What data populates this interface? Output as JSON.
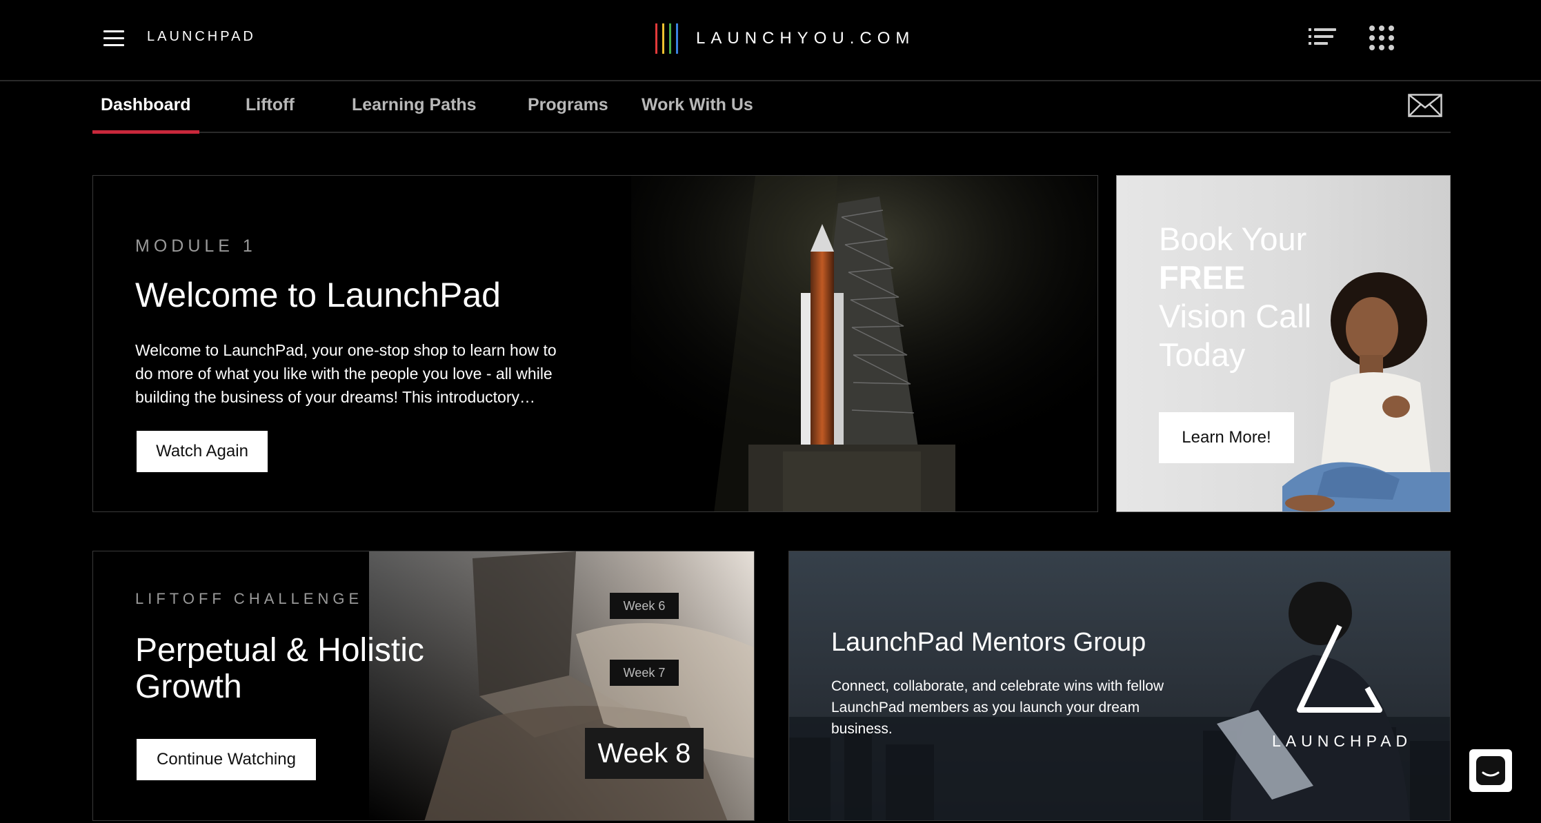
{
  "header": {
    "brand_left": "LAUNCHPAD",
    "logo_text": "LAUNCHYOU.COM",
    "logo_bar_colors": [
      "#e23a3a",
      "#f2c230",
      "#47b04a",
      "#3b82e0"
    ]
  },
  "nav": {
    "tabs": [
      {
        "label": "Dashboard",
        "active": true
      },
      {
        "label": "Liftoff"
      },
      {
        "label": "Learning Paths"
      },
      {
        "label": "Programs"
      },
      {
        "label": "Work With Us"
      }
    ],
    "accent_color": "#c8283b"
  },
  "welcome_card": {
    "eyebrow": "MODULE 1",
    "title": "Welcome to LaunchPad",
    "description": "Welcome to LaunchPad, your one-stop shop to learn how to do more of what you like with the people you love - all while building the business of your dreams! This introductory…",
    "button": "Watch Again"
  },
  "vision_card": {
    "line1": "Book Your",
    "line2": "FREE",
    "line3": "Vision Call",
    "line4": "Today",
    "button": "Learn More!"
  },
  "liftoff_card": {
    "eyebrow": "LIFTOFF CHALLENGE",
    "title_line1": "Perpetual & Holistic",
    "title_line2": "Growth",
    "button": "Continue Watching",
    "weeks": [
      "Week 6",
      "Week 7",
      "Week 8"
    ]
  },
  "mentors_card": {
    "title": "LaunchPad Mentors Group",
    "description": "Connect, collaborate, and celebrate wins with fellow LaunchPad members as you launch your dream business.",
    "logo_text": "LAUNCHPAD"
  },
  "icons": {
    "menu": "hamburger-menu-icon",
    "list": "list-icon",
    "apps": "apps-grid-icon",
    "mail": "mail-icon",
    "chat": "chat-icon"
  }
}
